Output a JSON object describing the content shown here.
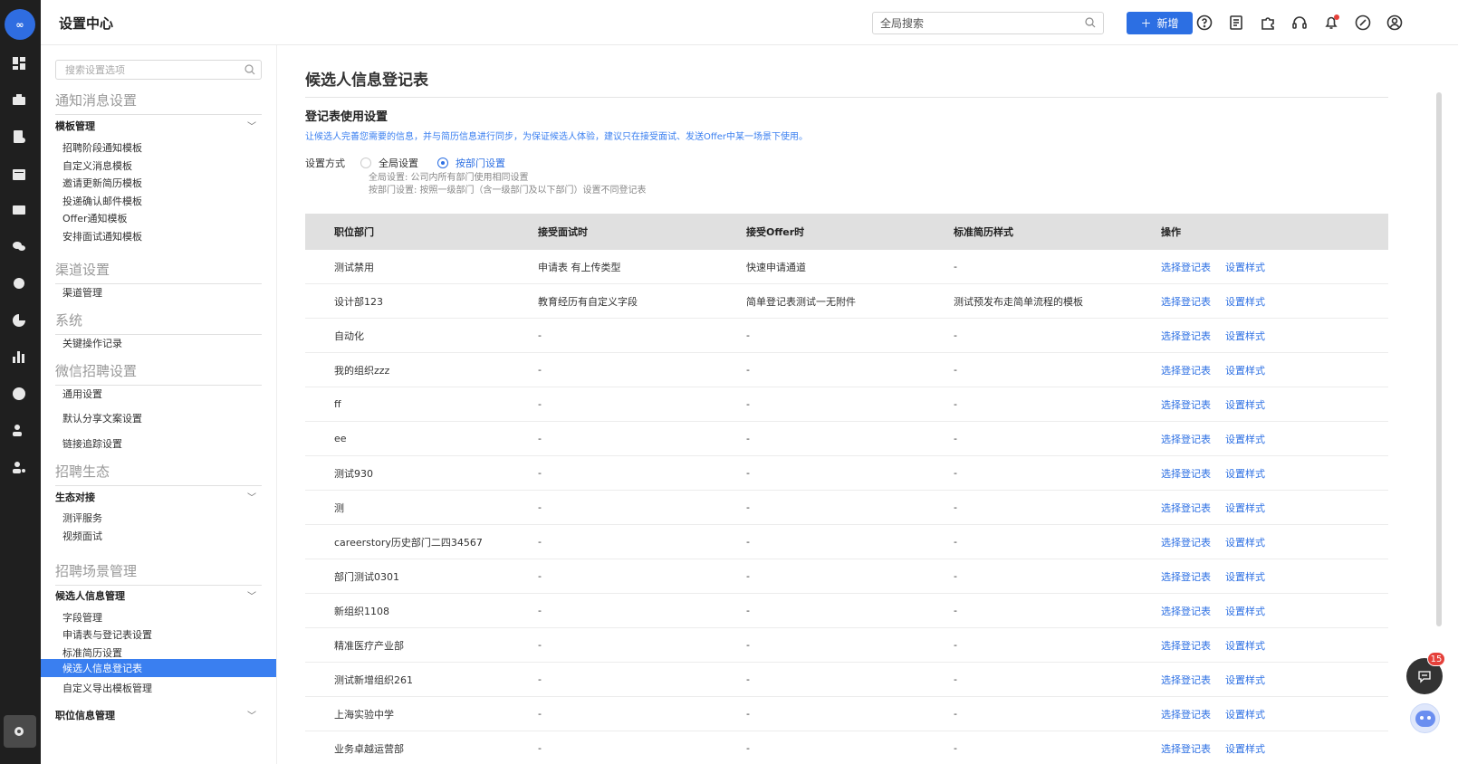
{
  "app": {
    "logo_text": "∞"
  },
  "header": {
    "title": "设置中心",
    "search_placeholder": "全局搜索",
    "new_button": "新增",
    "icons": [
      "help-icon",
      "document-icon",
      "puzzle-icon",
      "headset-icon",
      "bell-icon",
      "link-icon",
      "user-icon"
    ]
  },
  "sidebar": {
    "search_placeholder": "搜索设置选项",
    "groups": {
      "notify": "通知消息设置",
      "channel": "渠道设置",
      "system": "系统",
      "wechat": "微信招聘设置",
      "eco": "招聘生态",
      "scene": "招聘场景管理"
    },
    "subs": {
      "template": "模板管理",
      "eco_connect": "生态对接",
      "candidate": "候选人信息管理",
      "position": "职位信息管理"
    },
    "items": {
      "t1": "招聘阶段通知模板",
      "t2": "自定义消息模板",
      "t3": "邀请更新简历模板",
      "t4": "投递确认邮件模板",
      "t5": "Offer通知模板",
      "t6": "安排面试通知模板",
      "channel_mgmt": "渠道管理",
      "key_log": "关键操作记录",
      "general": "通用设置",
      "share_text": "默认分享文案设置",
      "link_track": "链接追踪设置",
      "assess": "测评服务",
      "video": "视频面试",
      "fields": "字段管理",
      "app_form": "申请表与登记表设置",
      "std_resume": "标准简历设置",
      "reg_form": "候选人信息登记表",
      "export_tpl": "自定义导出模板管理"
    }
  },
  "main": {
    "title": "候选人信息登记表",
    "section_title": "登记表使用设置",
    "description": "让候选人完善您需要的信息，并与简历信息进行同步，为保证候选人体验，建议只在接受面试、发送Offer中某一场景下使用。",
    "mode_label": "设置方式",
    "radio_global": "全局设置",
    "radio_dept": "按部门设置",
    "selected_mode": "按部门设置",
    "hint_global": "全局设置: 公司内所有部门使用相同设置",
    "hint_dept": "按部门设置: 按照一级部门（含一级部门及以下部门）设置不同登记表",
    "columns": [
      "职位部门",
      "接受面试时",
      "接受Offer时",
      "标准简历样式",
      "操作"
    ],
    "action_select": "选择登记表",
    "action_style": "设置样式",
    "rows": [
      [
        "测试禁用",
        "申请表 有上传类型",
        "快速申请通道",
        "-"
      ],
      [
        "设计部123",
        "教育经历有自定义字段",
        "简单登记表测试一无附件",
        "测试预发布走简单流程的模板"
      ],
      [
        "自动化",
        "-",
        "-",
        "-"
      ],
      [
        "我的组织zzz",
        "-",
        "-",
        "-"
      ],
      [
        "ff",
        "-",
        "-",
        "-"
      ],
      [
        "ee",
        "-",
        "-",
        "-"
      ],
      [
        "测试930",
        "-",
        "-",
        "-"
      ],
      [
        "测",
        "-",
        "-",
        "-"
      ],
      [
        "careerstory历史部门二四34567",
        "-",
        "-",
        "-"
      ],
      [
        "部门测试0301",
        "-",
        "-",
        "-"
      ],
      [
        "新组织1108",
        "-",
        "-",
        "-"
      ],
      [
        "精准医疗产业部",
        "-",
        "-",
        "-"
      ],
      [
        "测试新增组织261",
        "-",
        "-",
        "-"
      ],
      [
        "上海实验中学",
        "-",
        "-",
        "-"
      ],
      [
        "业务卓越运营部",
        "-",
        "-",
        "-"
      ]
    ]
  },
  "floating": {
    "chat_badge": "15"
  },
  "colors": {
    "accent": "#2c6fe3",
    "rail": "#1f1f1f",
    "active_item": "#3a7ff0"
  }
}
